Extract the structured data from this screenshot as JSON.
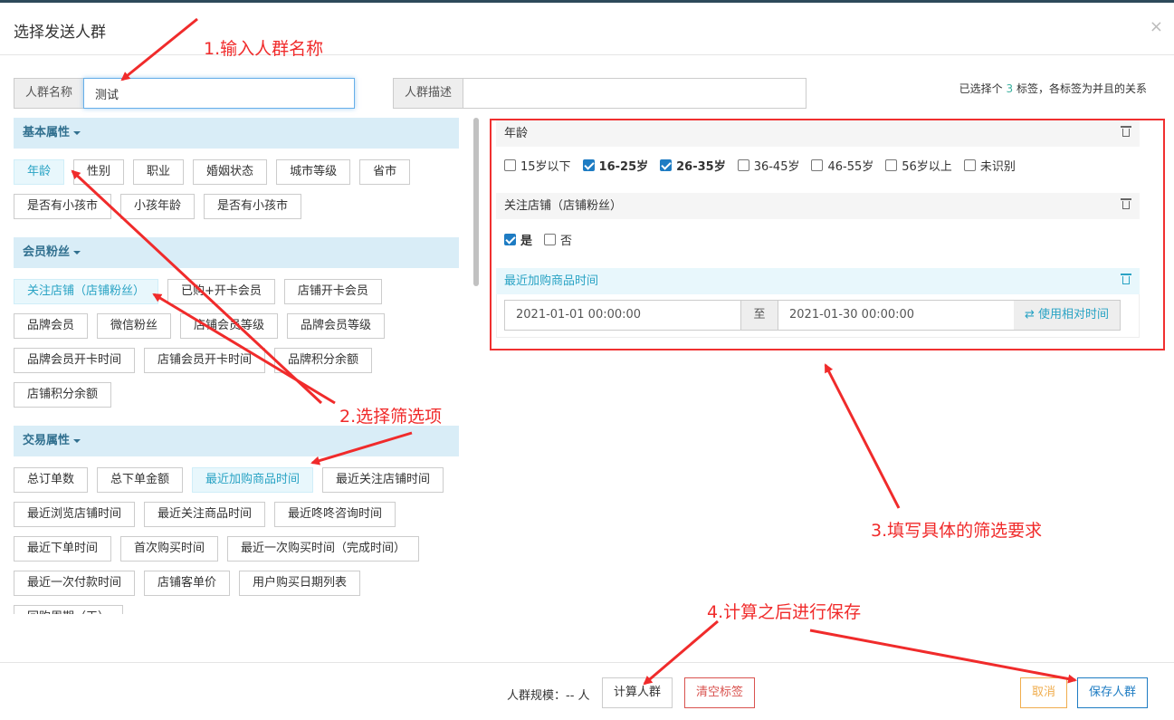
{
  "dialog": {
    "title": "选择发送人群",
    "close": "×"
  },
  "form": {
    "name_label": "人群名称",
    "name_value": "测试",
    "desc_label": "人群描述",
    "desc_value": ""
  },
  "selected_info": {
    "prefix": "已选择个",
    "count": "3",
    "suffix": "标签，各标签为并且的关系"
  },
  "groups": [
    {
      "title": "基本属性",
      "tags": [
        "年龄",
        "性别",
        "职业",
        "婚姻状态",
        "城市等级",
        "省市",
        "是否有小孩市",
        "小孩年龄",
        "是否有小孩市"
      ]
    },
    {
      "title": "会员粉丝",
      "tags": [
        "关注店铺（店铺粉丝）",
        "已购+开卡会员",
        "店铺开卡会员",
        "品牌会员",
        "微信粉丝",
        "店铺会员等级",
        "品牌会员等级",
        "品牌会员开卡时间",
        "店铺会员开卡时间",
        "品牌积分余额",
        "店铺积分余额"
      ]
    },
    {
      "title": "交易属性",
      "tags": [
        "总订单数",
        "总下单金额",
        "最近加购商品时间",
        "最近关注店铺时间",
        "最近浏览店铺时间",
        "最近关注商品时间",
        "最近咚咚咨询时间",
        "最近下单时间",
        "首次购买时间",
        "最近一次购买时间（完成时间）",
        "最近一次付款时间",
        "店铺客单价",
        "用户购买日期列表",
        "回购周期（天）"
      ]
    }
  ],
  "filters": {
    "age": {
      "title": "年龄",
      "options": [
        {
          "label": "15岁以下",
          "checked": false
        },
        {
          "label": "16-25岁",
          "checked": true
        },
        {
          "label": "26-35岁",
          "checked": true
        },
        {
          "label": "36-45岁",
          "checked": false
        },
        {
          "label": "46-55岁",
          "checked": false
        },
        {
          "label": "56岁以上",
          "checked": false
        },
        {
          "label": "未识别",
          "checked": false
        }
      ]
    },
    "follow": {
      "title": "关注店铺（店铺粉丝）",
      "options": [
        {
          "label": "是",
          "checked": true
        },
        {
          "label": "否",
          "checked": false
        }
      ]
    },
    "cart_time": {
      "title": "最近加购商品时间",
      "start": "2021-01-01 00:00:00",
      "sep": "至",
      "end": "2021-01-30 00:00:00",
      "relative_label": "使用相对时间"
    }
  },
  "footer": {
    "scale_label": "人群规模：-- 人",
    "calc_label": "计算人群",
    "clear_label": "清空标签",
    "cancel_label": "取消",
    "save_label": "保存人群"
  },
  "annotations": {
    "a1": "1.输入人群名称",
    "a2": "2.选择筛选项",
    "a3": "3.填写具体的筛选要求",
    "a4": "4.计算之后进行保存"
  },
  "colors": {
    "annotation": "#f02b2b",
    "primary": "#1e7cc3",
    "active_tag": "#29a3c4",
    "danger": "#d9534f",
    "warning": "#f0ad4e"
  }
}
